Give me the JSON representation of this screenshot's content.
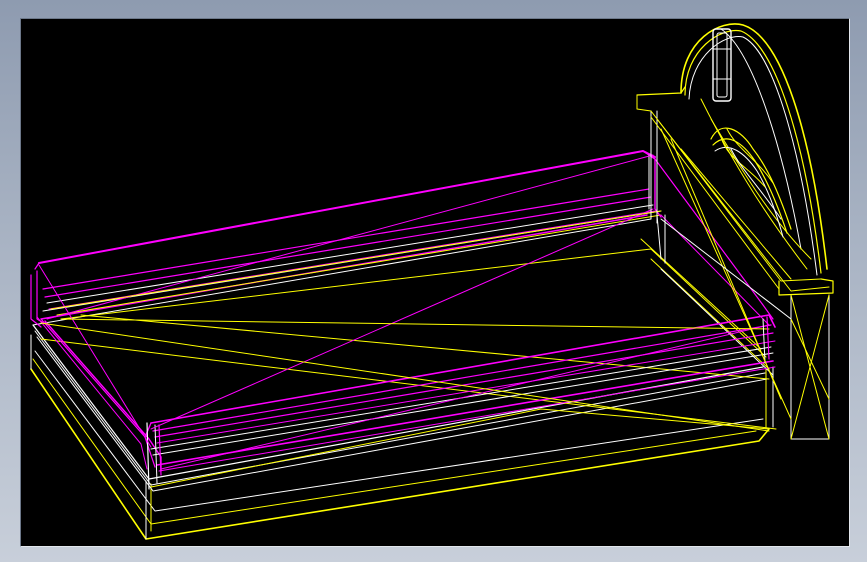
{
  "viewport": {
    "background": "#000000",
    "render_style": "wireframe",
    "subject": "bed-3d-model"
  },
  "colors": {
    "frame_top": "#8e9bb0",
    "frame_bottom": "#c8cfda",
    "mattress_wire": "#ff00ff",
    "base_wire": "#ffff00",
    "detail_wire": "#ffffff"
  },
  "parts": [
    "mattress",
    "bed-base",
    "headboard",
    "headboard-ornament"
  ]
}
